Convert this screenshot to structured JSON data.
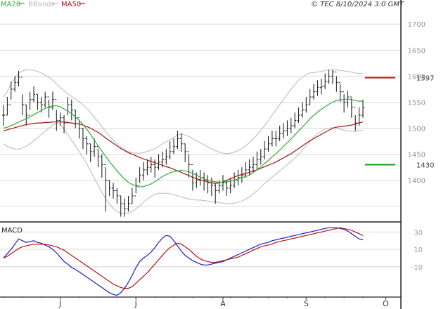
{
  "legend": {
    "ma20": "MA20",
    "bbands": "BBands",
    "ma50": "MA50",
    "ma20_color": "#33aa33",
    "bbands_color": "#b8b8b8",
    "ma50_color": "#aa1111"
  },
  "watermark": "© TEC 8/10/2024 3:0 GMT",
  "chart_data": [
    {
      "type": "ohlc",
      "ylim": [
        1320,
        1730
      ],
      "y_ticks": [
        1700,
        1650,
        1600,
        1550,
        1500,
        1450,
        1400
      ],
      "tick_labels": [
        "1700",
        "1650",
        "1600",
        "1550",
        "1500",
        "1450",
        "1400"
      ],
      "level_labels": [
        {
          "name": "resistance",
          "label": "1597",
          "value": 1597,
          "color": "#cc1111"
        },
        {
          "name": "support",
          "label": "1430",
          "value": 1430,
          "color": "#119911"
        }
      ],
      "x_tick_labels": [
        {
          "label": "J",
          "index": 15
        },
        {
          "label": "J",
          "index": 35
        },
        {
          "label": "A",
          "index": 58
        },
        {
          "label": "S",
          "index": 80
        },
        {
          "label": "O",
          "index": 101
        }
      ],
      "close": [
        1525,
        1545,
        1575,
        1588,
        1598,
        1545,
        1525,
        1555,
        1565,
        1550,
        1545,
        1560,
        1540,
        1555,
        1515,
        1520,
        1510,
        1545,
        1535,
        1520,
        1500,
        1480,
        1470,
        1455,
        1465,
        1445,
        1430,
        1400,
        1385,
        1380,
        1370,
        1355,
        1345,
        1355,
        1370,
        1390,
        1410,
        1420,
        1425,
        1430,
        1425,
        1435,
        1440,
        1445,
        1455,
        1465,
        1480,
        1470,
        1455,
        1430,
        1395,
        1400,
        1405,
        1400,
        1395,
        1390,
        1380,
        1390,
        1395,
        1385,
        1390,
        1400,
        1405,
        1410,
        1420,
        1425,
        1430,
        1440,
        1445,
        1460,
        1470,
        1480,
        1480,
        1490,
        1495,
        1500,
        1505,
        1515,
        1525,
        1535,
        1545,
        1560,
        1570,
        1578,
        1580,
        1590,
        1600,
        1608,
        1588,
        1570,
        1550,
        1560,
        1540,
        1510,
        1525,
        1540
      ],
      "high": [
        1545,
        1560,
        1590,
        1600,
        1610,
        1565,
        1545,
        1570,
        1580,
        1565,
        1560,
        1570,
        1555,
        1570,
        1535,
        1530,
        1525,
        1560,
        1555,
        1535,
        1515,
        1500,
        1485,
        1470,
        1480,
        1460,
        1450,
        1425,
        1400,
        1395,
        1385,
        1370,
        1365,
        1370,
        1385,
        1405,
        1425,
        1435,
        1440,
        1445,
        1440,
        1450,
        1455,
        1460,
        1475,
        1480,
        1495,
        1490,
        1470,
        1450,
        1420,
        1415,
        1420,
        1415,
        1410,
        1405,
        1395,
        1400,
        1410,
        1400,
        1405,
        1415,
        1420,
        1425,
        1435,
        1440,
        1445,
        1455,
        1460,
        1475,
        1485,
        1495,
        1495,
        1505,
        1510,
        1515,
        1520,
        1530,
        1540,
        1550,
        1560,
        1575,
        1585,
        1592,
        1595,
        1605,
        1612,
        1612,
        1600,
        1585,
        1565,
        1572,
        1558,
        1525,
        1540,
        1555
      ],
      "low": [
        1505,
        1525,
        1555,
        1570,
        1580,
        1525,
        1505,
        1535,
        1550,
        1535,
        1530,
        1540,
        1520,
        1535,
        1495,
        1505,
        1490,
        1525,
        1515,
        1500,
        1480,
        1460,
        1450,
        1435,
        1445,
        1425,
        1405,
        1340,
        1370,
        1365,
        1355,
        1330,
        1330,
        1340,
        1355,
        1375,
        1395,
        1400,
        1410,
        1415,
        1405,
        1420,
        1425,
        1430,
        1440,
        1450,
        1460,
        1455,
        1435,
        1405,
        1380,
        1385,
        1390,
        1380,
        1375,
        1370,
        1355,
        1375,
        1380,
        1370,
        1375,
        1385,
        1390,
        1395,
        1405,
        1410,
        1415,
        1420,
        1430,
        1440,
        1455,
        1465,
        1465,
        1475,
        1480,
        1485,
        1490,
        1500,
        1510,
        1520,
        1530,
        1545,
        1555,
        1562,
        1565,
        1575,
        1585,
        1585,
        1570,
        1550,
        1530,
        1540,
        1520,
        1495,
        1505,
        1520
      ],
      "ma20": [
        1500,
        1502,
        1505,
        1508,
        1512,
        1515,
        1518,
        1522,
        1526,
        1530,
        1534,
        1538,
        1541,
        1543,
        1543,
        1541,
        1537,
        1533,
        1528,
        1522,
        1515,
        1507,
        1498,
        1488,
        1477,
        1466,
        1456,
        1446,
        1436,
        1427,
        1418,
        1410,
        1402,
        1396,
        1392,
        1389,
        1387,
        1388,
        1390,
        1393,
        1397,
        1402,
        1407,
        1411,
        1414,
        1417,
        1418,
        1419,
        1418,
        1416,
        1413,
        1410,
        1406,
        1403,
        1400,
        1398,
        1397,
        1396,
        1396,
        1397,
        1398,
        1400,
        1403,
        1405,
        1407,
        1410,
        1415,
        1420,
        1426,
        1432,
        1438,
        1445,
        1451,
        1458,
        1465,
        1472,
        1479,
        1487,
        1495,
        1502,
        1510,
        1518,
        1525,
        1531,
        1536,
        1541,
        1546,
        1550,
        1553,
        1555,
        1555,
        1556,
        1555,
        1553,
        1552,
        1552
      ],
      "ma50": [
        1495,
        1497,
        1499,
        1501,
        1503,
        1505,
        1507,
        1508,
        1509,
        1510,
        1510,
        1511,
        1511,
        1512,
        1512,
        1512,
        1512,
        1511,
        1510,
        1509,
        1508,
        1506,
        1503,
        1500,
        1496,
        1492,
        1487,
        1481,
        1476,
        1471,
        1466,
        1461,
        1457,
        1453,
        1450,
        1447,
        1444,
        1441,
        1439,
        1436,
        1434,
        1431,
        1429,
        1426,
        1424,
        1421,
        1418,
        1415,
        1412,
        1409,
        1406,
        1403,
        1401,
        1399,
        1397,
        1395,
        1394,
        1395,
        1397,
        1400,
        1403,
        1406,
        1409,
        1411,
        1413,
        1415,
        1418,
        1420,
        1423,
        1426,
        1429,
        1432,
        1435,
        1439,
        1443,
        1447,
        1451,
        1456,
        1461,
        1466,
        1471,
        1476,
        1480,
        1484,
        1488,
        1492,
        1496,
        1500,
        1502,
        1503,
        1504,
        1505,
        1506,
        1508,
        1510,
        1512
      ],
      "bb_upper": [
        1560,
        1570,
        1585,
        1595,
        1605,
        1610,
        1612,
        1612,
        1611,
        1609,
        1606,
        1602,
        1598,
        1592,
        1585,
        1578,
        1572,
        1566,
        1561,
        1556,
        1551,
        1545,
        1538,
        1530,
        1521,
        1512,
        1503,
        1494,
        1485,
        1477,
        1470,
        1464,
        1459,
        1455,
        1453,
        1452,
        1452,
        1453,
        1455,
        1458,
        1461,
        1465,
        1470,
        1474,
        1478,
        1482,
        1487,
        1489,
        1487,
        1484,
        1480,
        1476,
        1472,
        1468,
        1464,
        1460,
        1457,
        1454,
        1452,
        1451,
        1452,
        1454,
        1457,
        1461,
        1466,
        1472,
        1479,
        1487,
        1496,
        1505,
        1515,
        1525,
        1535,
        1545,
        1555,
        1565,
        1575,
        1584,
        1592,
        1598,
        1603,
        1606,
        1607,
        1608,
        1609,
        1611,
        1612,
        1612,
        1612,
        1611,
        1610,
        1609,
        1608,
        1606,
        1605,
        1605
      ],
      "bb_lower": [
        1470,
        1465,
        1462,
        1460,
        1460,
        1462,
        1465,
        1470,
        1476,
        1482,
        1488,
        1494,
        1500,
        1506,
        1510,
        1506,
        1498,
        1488,
        1477,
        1466,
        1455,
        1444,
        1432,
        1418,
        1404,
        1390,
        1377,
        1365,
        1354,
        1346,
        1340,
        1337,
        1336,
        1337,
        1340,
        1345,
        1351,
        1358,
        1364,
        1369,
        1373,
        1375,
        1375,
        1375,
        1374,
        1372,
        1370,
        1368,
        1366,
        1364,
        1363,
        1362,
        1362,
        1361,
        1360,
        1359,
        1358,
        1357,
        1356,
        1355,
        1355,
        1356,
        1358,
        1360,
        1364,
        1368,
        1374,
        1380,
        1387,
        1394,
        1400,
        1406,
        1412,
        1418,
        1424,
        1430,
        1436,
        1443,
        1450,
        1458,
        1466,
        1474,
        1482,
        1489,
        1494,
        1498,
        1500,
        1501,
        1500,
        1498,
        1496,
        1495,
        1494,
        1494,
        1495,
        1496
      ]
    },
    {
      "type": "line",
      "title": "MACD",
      "ylim": [
        -45,
        40
      ],
      "y_ticks": [
        30,
        10,
        -10
      ],
      "tick_labels": [
        "30",
        "10",
        "-10"
      ],
      "series": [
        {
          "name": "",
          "color": "#1a1acc",
          "values": [
            0,
            5,
            10,
            16,
            22,
            20,
            18,
            19,
            20,
            18,
            17,
            15,
            13,
            10,
            6,
            1,
            -4,
            -7,
            -11,
            -13,
            -16,
            -19,
            -22,
            -25,
            -28,
            -31,
            -34,
            -37,
            -40,
            -42,
            -43,
            -40,
            -35,
            -28,
            -20,
            -11,
            -4,
            0,
            3,
            7,
            12,
            18,
            23,
            26,
            25,
            20,
            14,
            8,
            3,
            0,
            -3,
            -5,
            -7,
            -8,
            -8,
            -7,
            -6,
            -5,
            -4,
            -2,
            0,
            2,
            4,
            6,
            8,
            10,
            12,
            14,
            16,
            17,
            18,
            20,
            21,
            22,
            23,
            24,
            25,
            26,
            27,
            28,
            29,
            30,
            31,
            32,
            33,
            34,
            35,
            35,
            35,
            34,
            33,
            31,
            28,
            25,
            22,
            21
          ]
        },
        {
          "name": "",
          "color": "#bb1111",
          "values": [
            0,
            2,
            5,
            8,
            11,
            13,
            14,
            15,
            16,
            16,
            16,
            16,
            15,
            14,
            13,
            11,
            9,
            6,
            3,
            0,
            -3,
            -6,
            -9,
            -12,
            -15,
            -18,
            -21,
            -24,
            -27,
            -30,
            -32,
            -34,
            -35,
            -35,
            -33,
            -29,
            -25,
            -21,
            -17,
            -12,
            -7,
            -2,
            3,
            8,
            12,
            15,
            17,
            16,
            13,
            10,
            6,
            2,
            -1,
            -3,
            -4,
            -5,
            -5,
            -4,
            -3,
            -2,
            -1,
            0,
            1,
            3,
            5,
            7,
            9,
            11,
            13,
            14,
            15,
            16,
            18,
            19,
            20,
            21,
            22,
            23,
            24,
            25,
            26,
            27,
            28,
            29,
            30,
            31,
            32,
            33,
            34,
            35,
            34,
            33,
            32,
            30,
            28,
            26
          ]
        }
      ]
    }
  ]
}
